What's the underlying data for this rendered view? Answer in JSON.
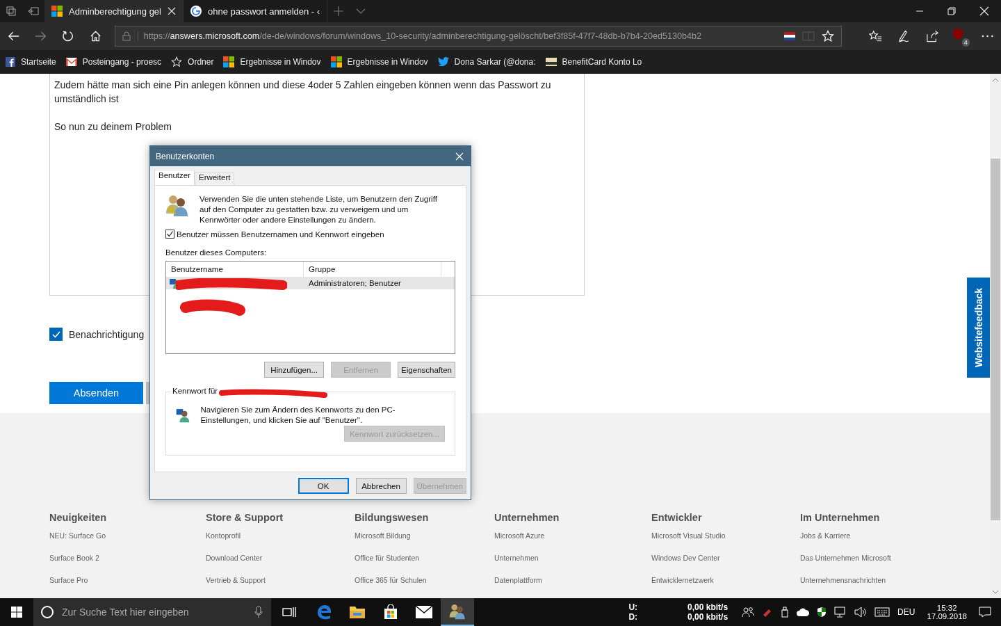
{
  "browser": {
    "tabs": [
      {
        "label": "Adminberechtigung gel",
        "kind": "windows",
        "selected": true
      },
      {
        "label": "ohne passwort anmelden - ‹",
        "kind": "google",
        "selected": false
      }
    ],
    "url": {
      "scheme": "https://",
      "host": "answers.microsoft.com",
      "path": "/de-de/windows/forum/windows_10-security/adminberechtigung-gelöscht/bef3f85f-47f7-48db-b7b4-20ed5130b4b2"
    },
    "extension_badge": "4",
    "bookmarks": [
      {
        "label": "Startseite",
        "kind": "facebook"
      },
      {
        "label": "Posteingang - proesc",
        "kind": "mail"
      },
      {
        "label": "Ordner",
        "kind": "star"
      },
      {
        "label": "Ergebnisse in Windov",
        "kind": "windows"
      },
      {
        "label": "Ergebnisse in Windov",
        "kind": "windows"
      },
      {
        "label": "Dona Sarkar (@dona:",
        "kind": "bird"
      },
      {
        "label": "BenefitCard Konto Lo",
        "kind": "card"
      }
    ]
  },
  "post": {
    "lines": [
      "Zudem hätte man sich eine Pin anlegen können und diese 4oder 5 Zahlen eingeben können wenn das Passwort zu umständlich ist",
      "So nun zu deinem Problem"
    ]
  },
  "notify": {
    "label": "Benachrichtigung",
    "checked": true
  },
  "submit": "Absenden",
  "feedback_tab": "Websitefeedback",
  "footer": [
    {
      "heading": "Neuigkeiten",
      "links": [
        "NEU: Surface Go",
        "Surface Book 2",
        "Surface Pro"
      ]
    },
    {
      "heading": "Store & Support",
      "links": [
        "Kontoprofil",
        "Download Center",
        "Vertrieb & Support"
      ]
    },
    {
      "heading": "Bildungswesen",
      "links": [
        "Microsoft Bildung",
        "Office für Studenten",
        "Office 365 für Schulen"
      ]
    },
    {
      "heading": "Unternehmen",
      "links": [
        "Microsoft Azure",
        "Unternehmen",
        "Datenplattform"
      ]
    },
    {
      "heading": "Entwickler",
      "links": [
        "Microsoft Visual Studio",
        "Windows Dev Center",
        "Entwicklernetzwerk"
      ]
    },
    {
      "heading": "Im Unternehmen",
      "links": [
        "Jobs & Karriere",
        "Das Unternehmen Microsoft",
        "Unternehmensnachrichten"
      ]
    }
  ],
  "dialog": {
    "title": "Benutzerkonten",
    "tabs": [
      {
        "label": "Benutzer",
        "selected": true
      },
      {
        "label": "Erweitert",
        "selected": false
      }
    ],
    "intro": "Verwenden Sie die unten stehende Liste, um Benutzern den Zugriff auf den Computer zu gestatten bzw. zu verweigern und um Kennwörter oder andere Einstellungen zu ändern.",
    "require_login": {
      "label": "Benutzer müssen Benutzernamen und Kennwort eingeben",
      "checked": true
    },
    "list_label": "Benutzer dieses Computers:",
    "columns": [
      "Benutzername",
      "Gruppe"
    ],
    "rows": [
      {
        "group": "Administratoren; Benutzer",
        "selected": true
      }
    ],
    "list_buttons": [
      {
        "label": "Hinzufügen...",
        "disabled": false
      },
      {
        "label": "Entfernen",
        "disabled": true
      },
      {
        "label": "Eigenschaften",
        "disabled": false
      }
    ],
    "password_group": {
      "legend": "Kennwort für",
      "text": "Navigieren Sie zum Ändern des Kennworts zu den PC-Einstellungen, und klicken Sie auf \"Benutzer\".",
      "button": {
        "label": "Kennwort zurücksetzen...",
        "disabled": true
      }
    },
    "footer_buttons": [
      {
        "label": "OK",
        "default": true,
        "disabled": false
      },
      {
        "label": "Abbrechen",
        "default": false,
        "disabled": false
      },
      {
        "label": "Übernehmen",
        "default": false,
        "disabled": true
      }
    ]
  },
  "taskbar": {
    "search_placeholder": "Zur Suche Text hier eingeben",
    "apps": [
      {
        "kind": "edge",
        "active": false
      },
      {
        "kind": "folder",
        "active": false
      },
      {
        "kind": "store",
        "active": false
      },
      {
        "kind": "mail",
        "active": false
      },
      {
        "kind": "users",
        "active": true
      }
    ],
    "net": [
      {
        "label": "U:",
        "value": "0,00 kbit/s"
      },
      {
        "label": "D:",
        "value": "0,00 kbit/s"
      }
    ],
    "language": "DEU",
    "time": "15:32",
    "date": "17.09.2018"
  }
}
